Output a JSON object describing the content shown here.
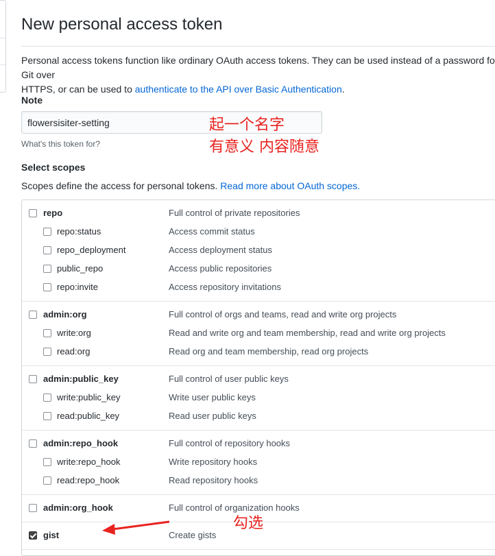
{
  "page": {
    "title": "New personal access token",
    "intro_text_1": "Personal access tokens function like ordinary OAuth access tokens. They can be used instead of a password for Git over",
    "intro_text_2": "HTTPS, or can be used to ",
    "intro_link": "authenticate to the API over Basic Authentication",
    "intro_end": "."
  },
  "note": {
    "label": "Note",
    "value": "flowersisiter-setting",
    "hint": "What's this token for?"
  },
  "annotations": {
    "name_hint_line1": "起一个名字",
    "name_hint_line2": "有意义 内容随意",
    "check_hint": "勾选"
  },
  "scopes": {
    "label": "Select scopes",
    "desc": "Scopes define the access for personal tokens. ",
    "link": "Read more about OAuth scopes.",
    "groups": [
      {
        "parent": {
          "name": "repo",
          "desc": "Full control of private repositories",
          "checked": false
        },
        "children": [
          {
            "name": "repo:status",
            "desc": "Access commit status"
          },
          {
            "name": "repo_deployment",
            "desc": "Access deployment status"
          },
          {
            "name": "public_repo",
            "desc": "Access public repositories"
          },
          {
            "name": "repo:invite",
            "desc": "Access repository invitations"
          }
        ]
      },
      {
        "parent": {
          "name": "admin:org",
          "desc": "Full control of orgs and teams, read and write org projects",
          "checked": false
        },
        "children": [
          {
            "name": "write:org",
            "desc": "Read and write org and team membership, read and write org projects"
          },
          {
            "name": "read:org",
            "desc": "Read org and team membership, read org projects"
          }
        ]
      },
      {
        "parent": {
          "name": "admin:public_key",
          "desc": "Full control of user public keys",
          "checked": false
        },
        "children": [
          {
            "name": "write:public_key",
            "desc": "Write user public keys"
          },
          {
            "name": "read:public_key",
            "desc": "Read user public keys"
          }
        ]
      },
      {
        "parent": {
          "name": "admin:repo_hook",
          "desc": "Full control of repository hooks",
          "checked": false
        },
        "children": [
          {
            "name": "write:repo_hook",
            "desc": "Write repository hooks"
          },
          {
            "name": "read:repo_hook",
            "desc": "Read repository hooks"
          }
        ]
      },
      {
        "parent": {
          "name": "admin:org_hook",
          "desc": "Full control of organization hooks",
          "checked": false
        },
        "children": []
      },
      {
        "parent": {
          "name": "gist",
          "desc": "Create gists",
          "checked": true
        },
        "children": []
      }
    ]
  }
}
